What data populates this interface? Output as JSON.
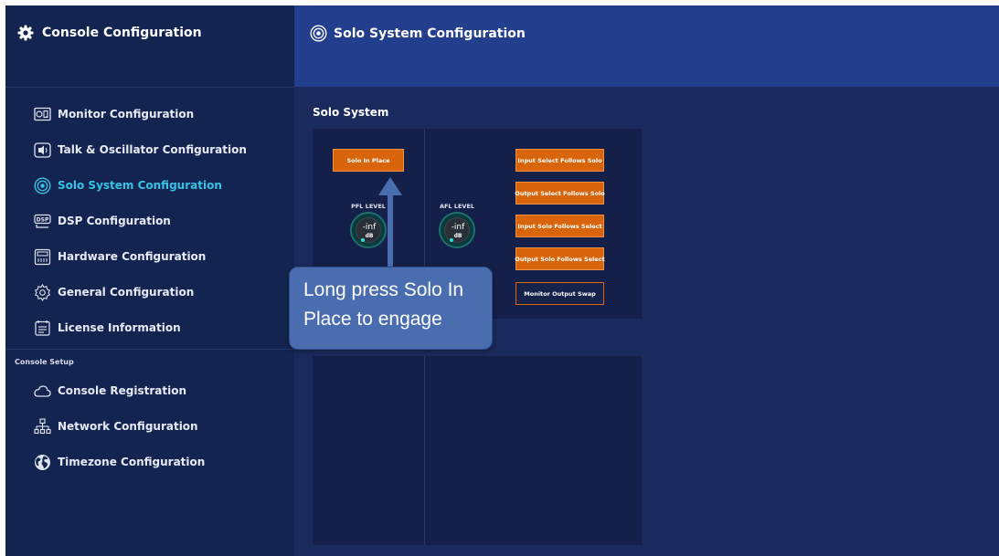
{
  "sidebar": {
    "title": "Console Configuration",
    "items": [
      {
        "label": "Monitor Configuration",
        "icon": "monitor-icon"
      },
      {
        "label": "Talk & Oscillator Configuration",
        "icon": "talkback-icon"
      },
      {
        "label": "Solo System Configuration",
        "icon": "solo-icon",
        "active": true
      },
      {
        "label": "DSP Configuration",
        "icon": "dsp-icon"
      },
      {
        "label": "Hardware Configuration",
        "icon": "hardware-icon"
      },
      {
        "label": "General Configuration",
        "icon": "gear-icon"
      },
      {
        "label": "License Information",
        "icon": "license-icon"
      }
    ],
    "section_label": "Console Setup",
    "setup_items": [
      {
        "label": "Console Registration",
        "icon": "cloud-icon"
      },
      {
        "label": "Network Configuration",
        "icon": "network-icon"
      },
      {
        "label": "Timezone Configuration",
        "icon": "globe-icon"
      }
    ]
  },
  "header": {
    "title": "Solo System Configuration"
  },
  "main": {
    "section_title": "Solo System",
    "solo_in_place": "Solo In Place",
    "pfl": {
      "label": "PFL LEVEL",
      "value": "-inf",
      "unit": "dB"
    },
    "afl": {
      "label": "AFL LEVEL",
      "value": "-inf",
      "unit": "dB"
    },
    "buttons": [
      "Input Select Follows Solo",
      "Output Select Follows Solo",
      "Input Solo Follows Select",
      "Output Solo Follows Select",
      "Monitor Output Swap"
    ]
  },
  "callout": {
    "text": "Long press Solo In Place to engage"
  },
  "colors": {
    "accent": "#35c3e6",
    "button_orange": "#d8650b",
    "sidebar_bg": "#142451",
    "header_bg": "#223e8c",
    "callout_bg": "#4a6db0"
  }
}
